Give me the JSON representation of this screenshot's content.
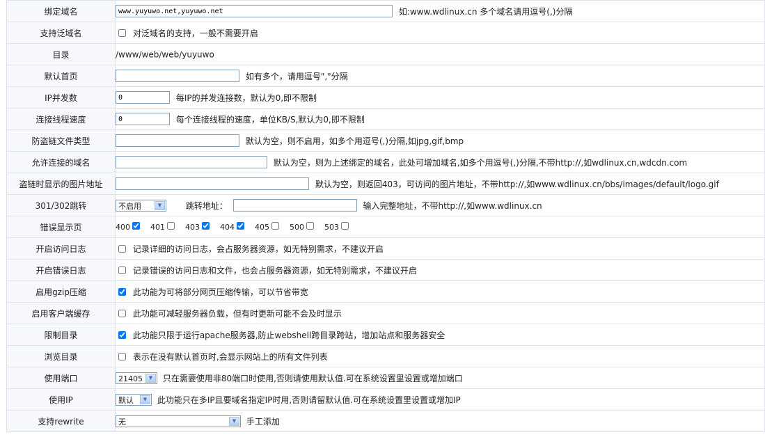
{
  "rows": {
    "domain": {
      "label": "绑定域名",
      "value": "www.yuyuwo.net,yuyuwo.net",
      "hint": "如:www.wdlinux.cn 多个域名请用逗号(,)分隔"
    },
    "wildcard": {
      "label": "支持泛域名",
      "checked": false,
      "hint": "对泛域名的支持，一般不需要开启"
    },
    "directory": {
      "label": "目录",
      "value": "/www/web/web/yuyuwo"
    },
    "default_page": {
      "label": "默认首页",
      "value": "",
      "hint": "如有多个，请用逗号\",\"分隔"
    },
    "ip_concurrency": {
      "label": "IP并发数",
      "value": "0",
      "hint": "每IP的并发连接数，默认为0,即不限制"
    },
    "thread_speed": {
      "label": "连接线程速度",
      "value": "0",
      "hint": "每个连接线程的速度，单位KB/S,默认为0,即不限制"
    },
    "hotlink_types": {
      "label": "防盗链文件类型",
      "value": "",
      "hint": "默认为空，则不启用，如多个用逗号(,)分隔,如jpg,gif,bmp"
    },
    "allowed_domains": {
      "label": "允许连接的域名",
      "value": "",
      "hint": "默认为空，则为上述绑定的域名，此处可增加域名,如多个用逗号(,)分隔,不带http://,如wdlinux.cn,wdcdn.com"
    },
    "hotlink_image": {
      "label": "盗链时显示的图片地址",
      "value": "",
      "hint": "默认为空，则返回403，可访问的图片地址，不带http://,如www.wdlinux.cn/bbs/images/default/logo.gif"
    },
    "redirect": {
      "label": "301/302跳转",
      "select": "不启用",
      "addr_label": "跳转地址：",
      "value": "",
      "hint": "输入完整地址，不带http://,如www.wdlinux.cn"
    },
    "error_pages": {
      "label": "错误显示页",
      "codes": [
        {
          "code": "400",
          "checked": true
        },
        {
          "code": "401",
          "checked": false
        },
        {
          "code": "403",
          "checked": true
        },
        {
          "code": "404",
          "checked": true
        },
        {
          "code": "405",
          "checked": false
        },
        {
          "code": "500",
          "checked": false
        },
        {
          "code": "503",
          "checked": false
        }
      ]
    },
    "access_log": {
      "label": "开启访问日志",
      "checked": false,
      "hint": "记录详细的访问日志，会占服务器资源，如无特别需求，不建议开启"
    },
    "error_log": {
      "label": "开启错误日志",
      "checked": false,
      "hint": "记录错误的访问日志和文件，也会占服务器资源，如无特别需求，不建议开启"
    },
    "gzip": {
      "label": "启用gzip压缩",
      "checked": true,
      "hint": "此功能为可将部分网页压缩传输，可以节省带宽"
    },
    "client_cache": {
      "label": "启用客户端缓存",
      "checked": false,
      "hint": "此功能可减轻服务器负载，但有时更新可能不会及时显示"
    },
    "restrict_dir": {
      "label": "限制目录",
      "checked": true,
      "hint": "此功能只限于运行apache服务器,防止webshell跨目录跨站，增加站点和服务器安全"
    },
    "browse_dir": {
      "label": "浏览目录",
      "checked": false,
      "hint": "表示在没有默认首页时,会显示网站上的所有文件列表"
    },
    "port": {
      "label": "使用端口",
      "select": "21405",
      "hint": "只在需要使用非80端口时使用,否则请使用默认值.可在系统设置里设置或增加端口"
    },
    "ip": {
      "label": "使用IP",
      "select": "默认",
      "hint": "此功能只在多IP且要域名指定IP时用,否则请留默认值.可在系统设置里设置或增加IP"
    },
    "rewrite": {
      "label": "支持rewrite",
      "select": "无",
      "hint": "手工添加"
    }
  }
}
